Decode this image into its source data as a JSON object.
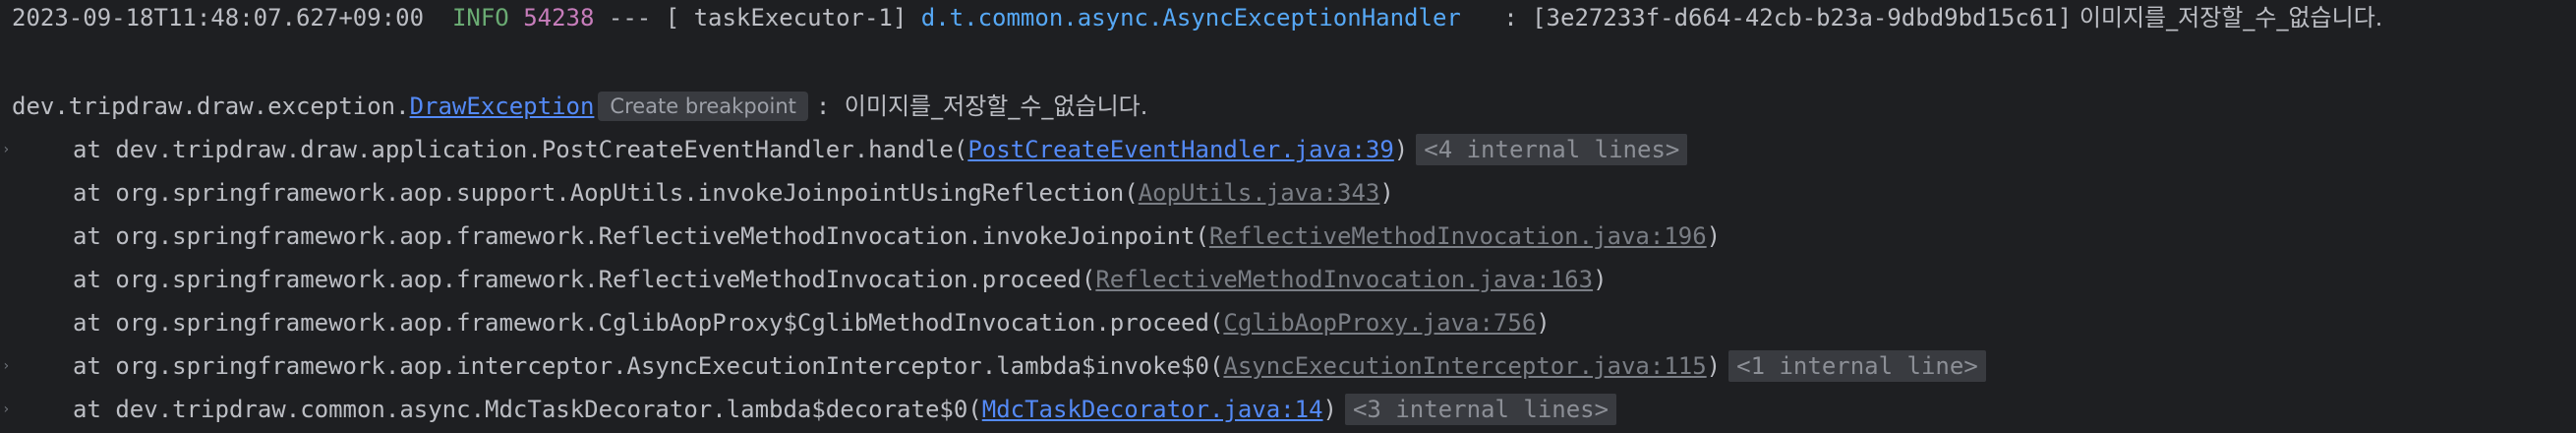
{
  "log_header": {
    "timestamp": "2023-09-18T11:48:07.627+09:00",
    "level": "INFO",
    "pid": "54238",
    "separator": " --- ",
    "thread": "[ taskExecutor-1]",
    "logger": "d.t.common.async.AsyncExceptionHandler",
    "colon": "   : ",
    "trace_id": "[3e27233f-d664-42cb-b23a-9dbd9bd15c61]",
    "message": " 이미지를_저장할_수_없습니다."
  },
  "exception": {
    "package": "dev.tripdraw.draw.exception.",
    "class_link": "DrawException",
    "breakpoint_label": "Create breakpoint",
    "separator": ": ",
    "message": "이미지를_저장할_수_없습니다."
  },
  "stack": [
    {
      "prefix": "at dev.tripdraw.draw.application.PostCreateEventHandler.handle(",
      "link": "PostCreateEventHandler.java:39",
      "suffix": ")",
      "link_style": "bright",
      "chip": "<4 internal lines>",
      "expandable": true
    },
    {
      "prefix": "at org.springframework.aop.support.AopUtils.invokeJoinpointUsingReflection(",
      "link": "AopUtils.java:343",
      "suffix": ")",
      "link_style": "dim",
      "chip": "",
      "expandable": false
    },
    {
      "prefix": "at org.springframework.aop.framework.ReflectiveMethodInvocation.invokeJoinpoint(",
      "link": "ReflectiveMethodInvocation.java:196",
      "suffix": ")",
      "link_style": "dim",
      "chip": "",
      "expandable": false
    },
    {
      "prefix": "at org.springframework.aop.framework.ReflectiveMethodInvocation.proceed(",
      "link": "ReflectiveMethodInvocation.java:163",
      "suffix": ")",
      "link_style": "dim",
      "chip": "",
      "expandable": false
    },
    {
      "prefix": "at org.springframework.aop.framework.CglibAopProxy$CglibMethodInvocation.proceed(",
      "link": "CglibAopProxy.java:756",
      "suffix": ")",
      "link_style": "dim",
      "chip": "",
      "expandable": false
    },
    {
      "prefix": "at org.springframework.aop.interceptor.AsyncExecutionInterceptor.lambda$invoke$0(",
      "link": "AsyncExecutionInterceptor.java:115",
      "suffix": ")",
      "link_style": "dim",
      "chip": "<1 internal line>",
      "expandable": true
    },
    {
      "prefix": "at dev.tripdraw.common.async.MdcTaskDecorator.lambda$decorate$0(",
      "link": "MdcTaskDecorator.java:14",
      "suffix": ")",
      "link_style": "bright",
      "chip": "<3 internal lines>",
      "expandable": true
    }
  ],
  "icons": {
    "fold_arrow": "chevron-right-icon",
    "fold_glyph": "›"
  },
  "colors": {
    "background": "#1e1f22",
    "text": "#bcbec4",
    "info": "#6aab73",
    "pid": "#c77dbb",
    "logger": "#56a8f5",
    "link": "#548af7",
    "link_dim": "#7a7e85"
  }
}
